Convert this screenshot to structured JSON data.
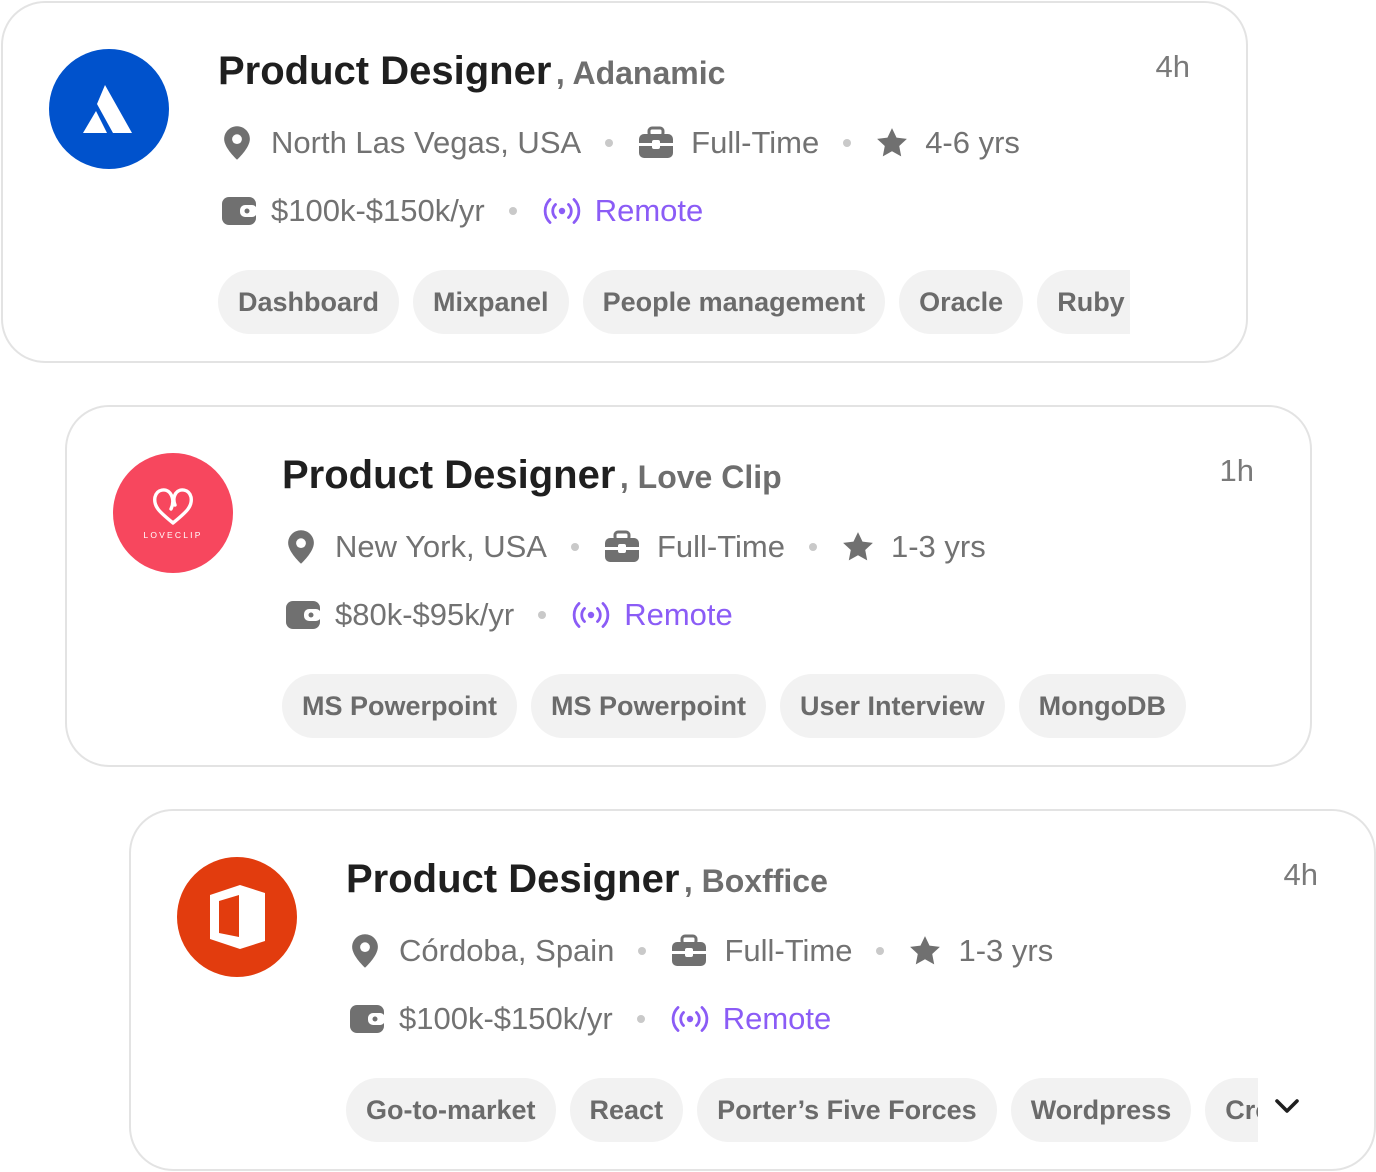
{
  "jobs": [
    {
      "title": "Product Designer",
      "company": ", Adanamic",
      "time": "4h",
      "location": "North Las Vegas, USA",
      "type": "Full-Time",
      "experience": "4-6 yrs",
      "salary": "$100k-$150k/yr",
      "mode": "Remote",
      "logo_color": "#0052CC",
      "logo_icon": "atlassian-logo",
      "tags": [
        "Dashboard",
        "Mixpanel",
        "People management",
        "Oracle",
        "Ruby on Rails"
      ]
    },
    {
      "title": "Product Designer",
      "company": ", Love Clip",
      "time": "1h",
      "location": "New York, USA",
      "type": "Full-Time",
      "experience": "1-3 yrs",
      "salary": "$80k-$95k/yr",
      "mode": "Remote",
      "logo_color": "#F7475E",
      "logo_icon": "loveclip-logo",
      "logo_text": "LOVECLIP",
      "tags": [
        "MS Powerpoint",
        "MS Powerpoint",
        "User Interview",
        "MongoDB"
      ]
    },
    {
      "title": "Product Designer",
      "company": ", Boxffice",
      "time": "4h",
      "location": "Córdoba, Spain",
      "type": "Full-Time",
      "experience": "1-3 yrs",
      "salary": "$100k-$150k/yr",
      "mode": "Remote",
      "logo_color": "#E23C0E",
      "logo_icon": "office-logo",
      "tags": [
        "Go-to-market",
        "React",
        "Porter’s Five Forces",
        "Wordpress",
        "Cross-functional"
      ]
    }
  ],
  "colors": {
    "accent": "#8B5CF6",
    "title": "#1F1F1F",
    "meta": "#727272",
    "tag_bg": "#F2F2F2",
    "border": "#E3E3E3"
  }
}
